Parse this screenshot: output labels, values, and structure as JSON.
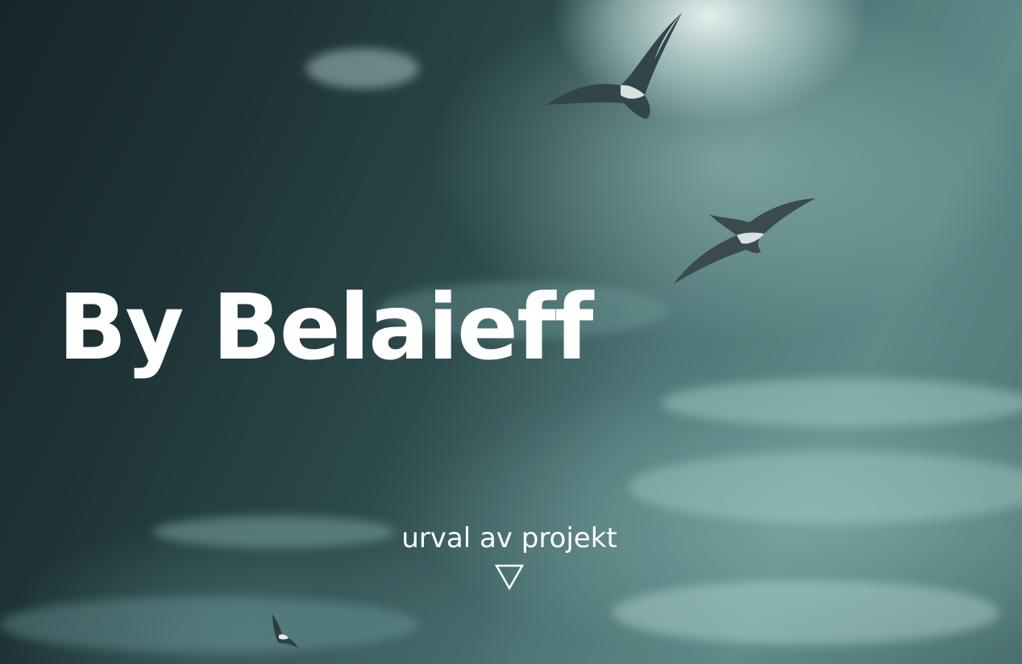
{
  "hero": {
    "title": "By Belaieff",
    "cta_label": "urval av projekt",
    "cta_icon": "down-triangle-outline-icon",
    "background": "stormy-teal-sky-with-seagulls",
    "accent_color": "#ffffff",
    "sky_colors": [
      "#172628",
      "#2d4a4c",
      "#5f8a88",
      "#ecf6f4"
    ]
  }
}
